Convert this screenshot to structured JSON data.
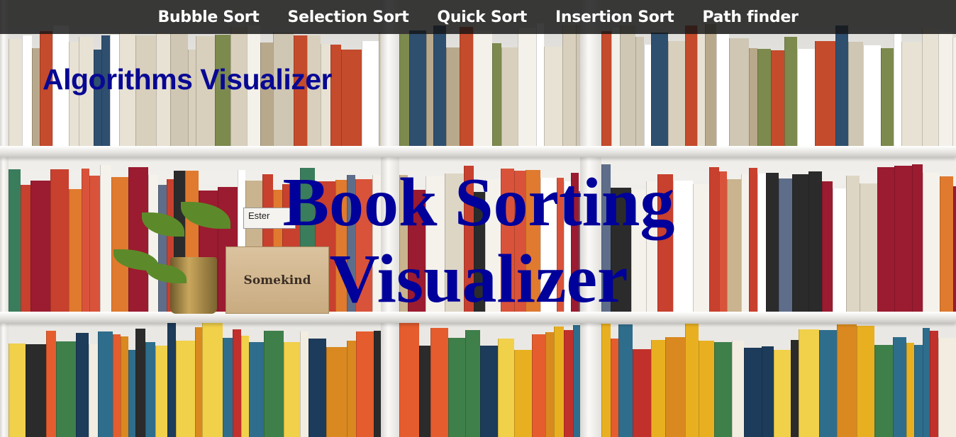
{
  "nav": {
    "items": [
      {
        "label": "Bubble Sort"
      },
      {
        "label": "Selection Sort"
      },
      {
        "label": "Quick Sort"
      },
      {
        "label": "Insertion Sort"
      },
      {
        "label": "Path finder"
      }
    ]
  },
  "brand": {
    "title": "Algorithms Visualizer"
  },
  "hero": {
    "line1": "Book Sorting",
    "line2": "Visualizer"
  },
  "decor": {
    "tag_text": "Ester",
    "crate_text": "Somekind"
  },
  "colors": {
    "nav_bg": "#141414",
    "nav_text": "#ffffff",
    "brand_text": "#080894",
    "headline_text": "#00009a"
  }
}
